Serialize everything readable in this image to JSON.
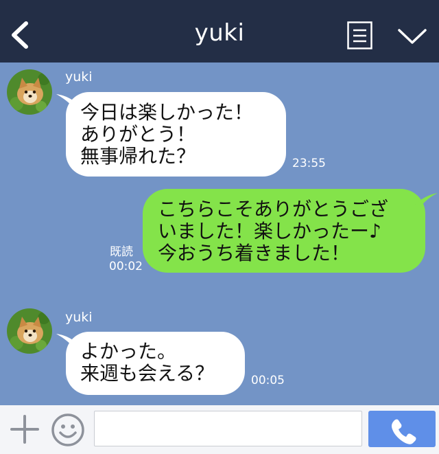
{
  "header": {
    "title": "yuki"
  },
  "messages": [
    {
      "sender": "yuki",
      "direction": "in",
      "lines": [
        "今日は楽しかった！",
        "ありがとう！",
        "無事帰れた？"
      ],
      "time": "23:55"
    },
    {
      "direction": "out",
      "lines": [
        "こちらこそありがとうござ",
        "いました！楽しかったー♪",
        "今おうち着きました！"
      ],
      "read": "既読",
      "time": "00:02"
    },
    {
      "sender": "yuki",
      "direction": "in",
      "lines": [
        "よかった。",
        "来週も会える？"
      ],
      "time": "00:05"
    }
  ],
  "input": {
    "placeholder": ""
  },
  "colors": {
    "header": "#232e46",
    "chat_bg": "#7394c6",
    "outgoing_bubble": "#84e34a",
    "incoming_bubble": "#ffffff",
    "send_button": "#5f8fe8"
  },
  "icons": {
    "back": "chevron-left-icon",
    "menu": "list-icon",
    "collapse": "chevron-down-icon",
    "add": "plus-icon",
    "emoji": "smiley-icon",
    "call": "phone-icon"
  }
}
